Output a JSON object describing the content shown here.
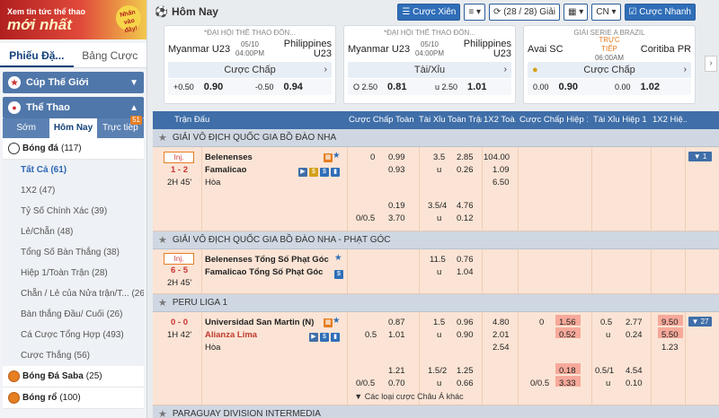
{
  "banner": {
    "line1": "Xem tin tức thể thao",
    "line2": "mới nhất",
    "badge": "Nhấn vào đây!"
  },
  "sidebar": {
    "tabs": [
      "Phiếu Đặ...",
      "Bảng Cược"
    ],
    "panels": {
      "cup": "Cúp Thế Giới",
      "sports": "Thể Thao"
    },
    "subtabs": [
      {
        "label": "Sớm"
      },
      {
        "label": "Hôm Nay"
      },
      {
        "label": "Trực tiếp",
        "count": "51"
      }
    ],
    "football": {
      "label": "Bóng đá",
      "count": "(117)"
    },
    "menu": [
      {
        "label": "Tất Cả",
        "count": "(61)"
      },
      {
        "label": "1X2",
        "count": "(47)"
      },
      {
        "label": "Tỷ Số Chính Xác",
        "count": "(39)"
      },
      {
        "label": "Lẻ/Chẵn",
        "count": "(48)"
      },
      {
        "label": "Tổng Số Bàn Thắng",
        "count": "(38)"
      },
      {
        "label": "Hiệp 1/Toàn Trận",
        "count": "(28)"
      },
      {
        "label": "Chẵn / Lẻ của Nửa trận/T...",
        "count": "(26)"
      },
      {
        "label": "Bàn thắng Đầu/ Cuối",
        "count": "(26)"
      },
      {
        "label": "Cá Cược Tổng Hợp",
        "count": "(493)"
      },
      {
        "label": "Cược Thắng",
        "count": "(56)"
      }
    ],
    "saba": {
      "label": "Bóng Đá Saba",
      "count": "(25)"
    },
    "basket": {
      "label": "Bóng rổ",
      "count": "(100)"
    }
  },
  "topbar": {
    "title": "Hôm Nay",
    "xien": "Cược Xiên",
    "count": "(28 / 28) Giải",
    "lang": "CN",
    "quick": "Cược Nhanh"
  },
  "cards": [
    {
      "league": "*ĐẠI HỘI THỂ THAO ĐÔN...",
      "home": "Myanmar U23",
      "date": "05/10",
      "time": "04:00PM",
      "away": "Philippines U23",
      "market": "Cược Chấp",
      "h": "+0.50",
      "ho": "0.90",
      "a": "-0.50",
      "ao": "0.94"
    },
    {
      "league": "*ĐẠI HỘI THỂ THAO ĐÔN...",
      "home": "Myanmar U23",
      "date": "05/10",
      "time": "04:00PM",
      "away": "Philippines U23",
      "market": "Tài/Xỉu",
      "h": "O 2.50",
      "ho": "0.81",
      "a": "u 2.50",
      "ao": "1.01"
    },
    {
      "league": "GIẢI SERIE A BRAZIL",
      "home": "Avai SC",
      "date": "TRỰC TIẾP",
      "time": "06:00AM",
      "away": "Coritiba PR",
      "market": "Cược Chấp",
      "h": "0.00",
      "ho": "0.90",
      "a": "0.00",
      "ao": "1.02"
    }
  ],
  "grid": {
    "headers": [
      "Trận Đấu",
      "Cược Chấp Toàn ...",
      "Tài Xỉu Toàn Trận",
      "1X2 Toà...",
      "Cược Chấp Hiệp 1",
      "Tài Xỉu Hiệp 1",
      "1X2 Hiệ..."
    ],
    "leagues": [
      "GIẢI VÔ ĐỊCH QUỐC GIA BỒ ĐÀO NHA",
      "GIẢI VÔ ĐỊCH QUỐC GIA BỒ ĐÀO NHA - PHẠT GÓC",
      "PERU LIGA 1",
      "PARAGUAY DIVISION INTERMEDIA"
    ],
    "inj": "Inj.",
    "m1": {
      "score": "1 - 2",
      "time": "2H 45'",
      "home": "Belenenses",
      "away": "Famalicao",
      "draw": "Hòa",
      "r1": {
        "hc": "0",
        "ho": "0.99",
        "ou": "3.5",
        "oo": "2.85",
        "x": "104.00"
      },
      "r2": {
        "ho": "0.93",
        "ou": "u",
        "oo": "0.26",
        "x": "1.09"
      },
      "r3": {
        "x": "6.50"
      },
      "r4": {
        "ho": "0.19",
        "ou": "3.5/4",
        "oo": "4.76"
      },
      "r5": {
        "hc": "0/0.5",
        "ho": "3.70",
        "ou": "u",
        "oo": "0.12"
      },
      "more": "▼ 1"
    },
    "m2": {
      "score": "6 - 5",
      "time": "2H 45'",
      "home": "Belenenses Tổng Số Phạt Góc",
      "away": "Famalicao Tổng Số Phạt Góc",
      "r1": {
        "ou": "11.5",
        "oo": "0.76"
      },
      "r2": {
        "ou": "u",
        "oo": "1.04"
      }
    },
    "m3": {
      "score": "0 - 0",
      "time": "1H 42'",
      "home": "Universidad San Martin (N)",
      "away": "Alianza Lima",
      "draw": "Hòa",
      "r1": {
        "ho": "0.87",
        "ou": "1.5",
        "oo": "0.96",
        "x": "4.80",
        "h1c": "0",
        "h1o": "1.56",
        "h1ou": "0.5",
        "h1oo": "2.77",
        "h1x": "9.50"
      },
      "r2": {
        "hc": "0.5",
        "ho": "1.01",
        "ou": "u",
        "oo": "0.90",
        "x": "2.01",
        "h1o": "0.52",
        "h1ou": "u",
        "h1oo": "0.24",
        "h1x": "5.50"
      },
      "r3": {
        "x": "2.54",
        "h1x": "1.23"
      },
      "r4": {
        "ho": "1.21",
        "ou": "1.5/2",
        "oo": "1.25",
        "h1o": "0.18",
        "h1ou": "0.5/1",
        "h1oo": "4.54"
      },
      "r5": {
        "hc": "0/0.5",
        "ho": "0.70",
        "ou": "u",
        "oo": "0.66",
        "h1c": "0/0.5",
        "h1o": "3.33",
        "h1ou": "u",
        "h1oo": "0.10"
      },
      "more": "▼ 27",
      "others": "▼ Các loại cược Châu Á khác"
    }
  }
}
